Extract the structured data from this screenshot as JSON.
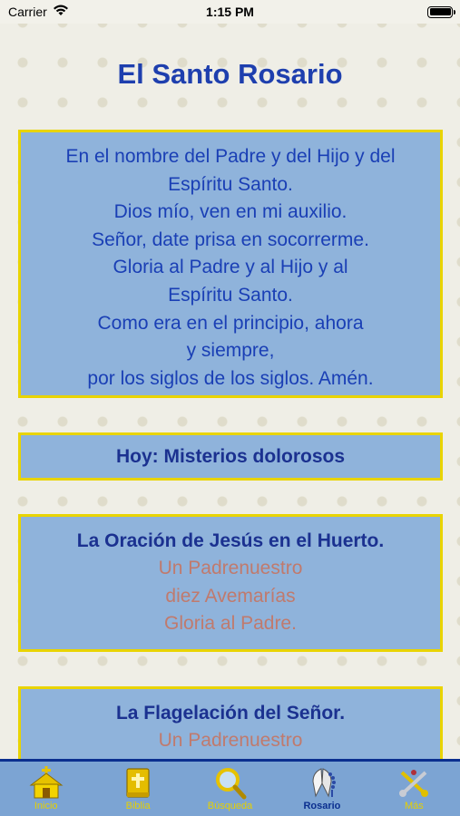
{
  "status_bar": {
    "carrier": "Carrier",
    "time": "1:15 PM"
  },
  "title": "El Santo Rosario",
  "prayer": {
    "lines": [
      "En el nombre del Padre y del Hijo y del",
      "Espíritu Santo.",
      "Dios mío, ven en mi auxilio.",
      "Señor, date prisa en socorrerme.",
      "Gloria al Padre y al Hijo y al",
      "Espíritu Santo.",
      "Como era en el principio, ahora",
      "y siempre,",
      "por los siglos de los siglos. Amén."
    ]
  },
  "today": "Hoy: Misterios dolorosos",
  "mysteries": [
    {
      "title": "La Oración de Jesús en el Huerto.",
      "lines": [
        "Un Padrenuestro",
        "diez Avemarías",
        "Gloria al Padre."
      ]
    },
    {
      "title": "La Flagelación del Señor.",
      "lines": [
        "Un Padrenuestro"
      ]
    }
  ],
  "tabs": [
    {
      "label": "Inicio",
      "icon": "church-icon"
    },
    {
      "label": "Biblia",
      "icon": "bible-icon"
    },
    {
      "label": "Búsqueda",
      "icon": "magnifier-icon"
    },
    {
      "label": "Rosario",
      "icon": "praying-hands-icon",
      "active": true
    },
    {
      "label": "Más",
      "icon": "keys-icon"
    }
  ],
  "colors": {
    "title": "#1e3fae",
    "card_bg": "#8fb3db",
    "card_border": "#e9d400",
    "tab_bg": "#7ca4d3",
    "tab_label": "#e7d000"
  }
}
